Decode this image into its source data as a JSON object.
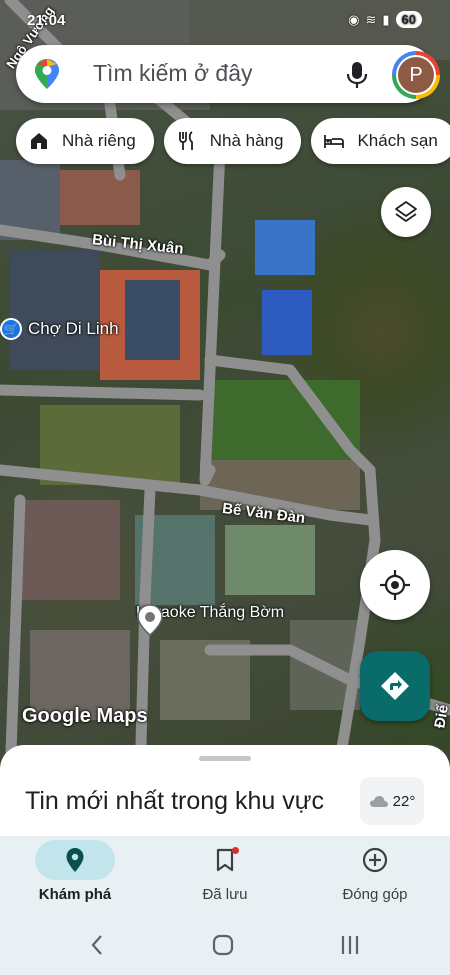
{
  "status_bar": {
    "time": "21:04",
    "battery": "60"
  },
  "search": {
    "placeholder": "Tìm kiếm ở đây",
    "avatar_initial": "P"
  },
  "chips": [
    {
      "label": "Nhà riêng",
      "icon": "home-icon"
    },
    {
      "label": "Nhà hàng",
      "icon": "restaurant-icon"
    },
    {
      "label": "Khách sạn",
      "icon": "hotel-icon"
    }
  ],
  "map": {
    "street_labels": [
      "Bùi Thị Xuân",
      "Bế Văn Đàn",
      "Ngô Vương",
      "Điể"
    ],
    "places": [
      {
        "label": "Chợ Di Linh",
        "icon": "shopping-cart-icon"
      },
      {
        "label": "Karaoke Thắng Bờm",
        "icon": "place-pin-icon"
      }
    ],
    "logo": "Google Maps"
  },
  "bottom_sheet": {
    "title": "Tin mới nhất trong khu vực",
    "weather": "22°"
  },
  "nav": {
    "items": [
      {
        "label": "Khám phá",
        "icon": "explore-pin-icon",
        "active": true
      },
      {
        "label": "Đã lưu",
        "icon": "bookmark-icon",
        "active": false
      },
      {
        "label": "Đóng góp",
        "icon": "add-circle-icon",
        "active": false
      }
    ]
  },
  "colors": {
    "accent_teal": "#0a6b6b",
    "nav_active": "#c1e5ea",
    "nav_bg": "#e9f0f4"
  }
}
